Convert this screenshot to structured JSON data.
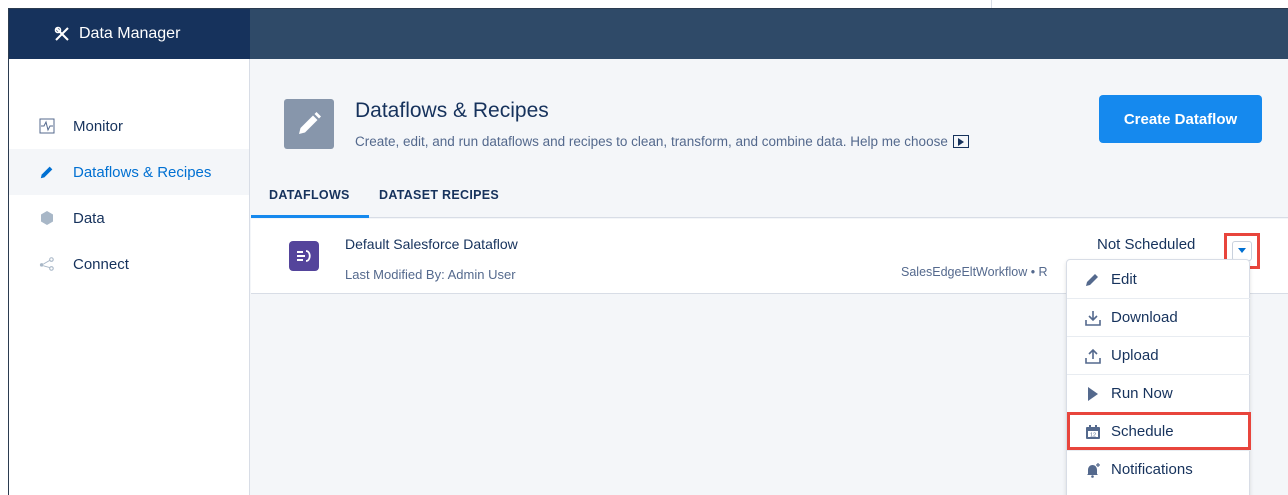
{
  "app": {
    "title": "Data Manager"
  },
  "sidebar": {
    "items": [
      {
        "label": "Monitor",
        "icon": "monitor-icon"
      },
      {
        "label": "Dataflows & Recipes",
        "icon": "pencil-icon",
        "active": true
      },
      {
        "label": "Data",
        "icon": "hexagon-icon"
      },
      {
        "label": "Connect",
        "icon": "connect-icon"
      }
    ]
  },
  "header": {
    "title": "Dataflows & Recipes",
    "subtitle": "Create, edit, and run dataflows and recipes to clean, transform, and combine data. Help me choose",
    "create_button": "Create Dataflow"
  },
  "tabs": [
    {
      "label": "DATAFLOWS",
      "active": true
    },
    {
      "label": "DATASET RECIPES",
      "active": false
    }
  ],
  "dataflow": {
    "name": "Default Salesforce Dataflow",
    "modified": "Last Modified By: Admin User",
    "status": "Not Scheduled",
    "meta": "SalesEdgeEltWorkflow • R"
  },
  "menu": {
    "items": [
      {
        "label": "Edit",
        "icon": "pencil-icon"
      },
      {
        "label": "Download",
        "icon": "download-icon"
      },
      {
        "label": "Upload",
        "icon": "upload-icon"
      },
      {
        "label": "Run Now",
        "icon": "play-icon"
      },
      {
        "label": "Schedule",
        "icon": "calendar-icon",
        "highlighted": true
      },
      {
        "label": "Notifications",
        "icon": "bell-icon"
      }
    ]
  },
  "colors": {
    "brand": "#16325c",
    "topbar": "#2f4a68",
    "accent": "#1589ee",
    "highlight": "#e8453c",
    "flow_icon": "#54449b"
  }
}
